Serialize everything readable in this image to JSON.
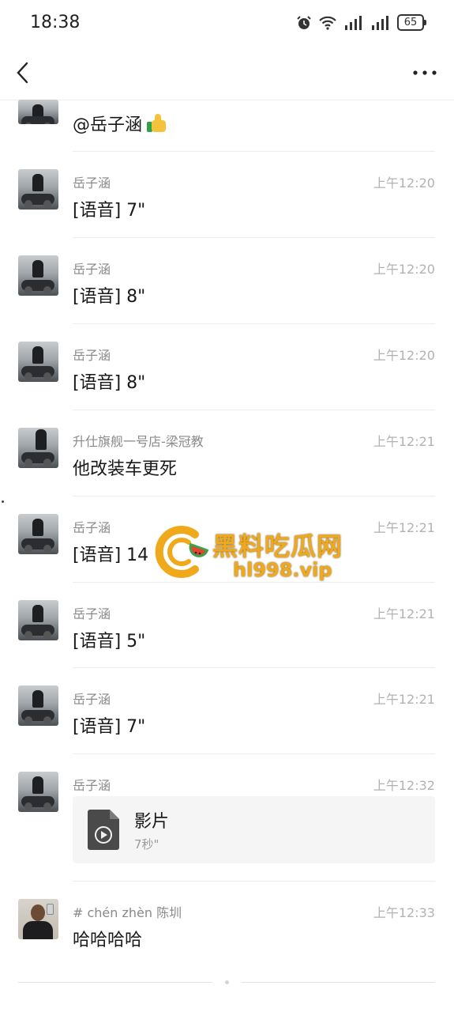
{
  "status_bar": {
    "time": "18:38",
    "battery": "65",
    "icons": [
      "alarm-icon",
      "wifi-icon",
      "signal-icon",
      "signal-icon",
      "battery-icon"
    ]
  },
  "nav": {
    "back_icon": "chevron-left-icon",
    "more_icon": "more-dots-icon"
  },
  "messages": [
    {
      "name": "",
      "time": "",
      "text": "@岳子涵",
      "emoji": "thumbs-up-icon"
    },
    {
      "name": "岳子涵",
      "time": "上午12:20",
      "text": "[语音] 7\""
    },
    {
      "name": "岳子涵",
      "time": "上午12:20",
      "text": "[语音] 8\""
    },
    {
      "name": "岳子涵",
      "time": "上午12:20",
      "text": "[语音] 8\""
    },
    {
      "name": "升仕旗舰一号店-梁冠教",
      "time": "上午12:21",
      "text": "他改装车更死"
    },
    {
      "name": "岳子涵",
      "time": "上午12:21",
      "text": "[语音] 14"
    },
    {
      "name": "岳子涵",
      "time": "上午12:21",
      "text": "[语音] 5\""
    },
    {
      "name": "岳子涵",
      "time": "上午12:21",
      "text": "[语音] 7\""
    },
    {
      "name": "岳子涵",
      "time": "上午12:32",
      "video": {
        "title": "影片",
        "duration": "7秒\""
      }
    },
    {
      "name": "# chén zhèn   陈圳",
      "time": "上午12:33",
      "text": "哈哈哈哈"
    }
  ],
  "watermark": {
    "title": "黑料吃瓜网",
    "url": "hl998.vip",
    "colors": {
      "main": "#f0a91a",
      "accent": "#e8412f",
      "green": "#3aa34a"
    }
  }
}
